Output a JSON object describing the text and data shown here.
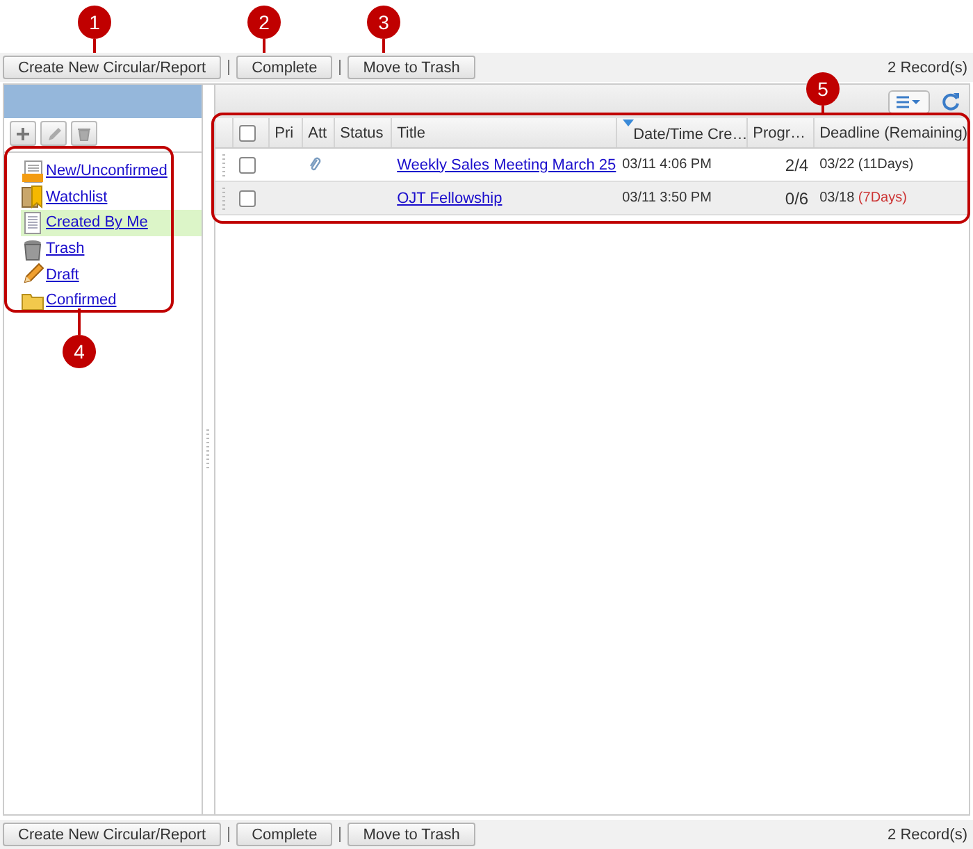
{
  "toolbar_top": {
    "buttons": [
      "Create New Circular/Report",
      "Complete",
      "Move to Trash"
    ],
    "record_count": "2 Record(s)"
  },
  "sidebar": {
    "items": [
      {
        "label": "New/Unconfirmed",
        "kind": "new",
        "selected": false
      },
      {
        "label": "Watchlist",
        "kind": "watch",
        "selected": false
      },
      {
        "label": "Created By Me",
        "kind": "doc",
        "selected": true
      },
      {
        "label": "Trash",
        "kind": "trash",
        "selected": false
      },
      {
        "label": "Draft",
        "kind": "draft",
        "selected": false
      },
      {
        "label": "Confirmed",
        "kind": "folder",
        "selected": false
      }
    ]
  },
  "table": {
    "select_all": {
      "checked": false
    },
    "columns": [
      {
        "label": "Pri",
        "sorted": false
      },
      {
        "label": "Att",
        "sorted": false
      },
      {
        "label": "Status",
        "sorted": false
      },
      {
        "label": "Title",
        "sorted": false
      },
      {
        "label": "Date/Time Cre…",
        "sorted": true
      },
      {
        "label": "Progr…",
        "sorted": false
      },
      {
        "label": "Deadline (Remaining)",
        "sorted": false
      }
    ],
    "rows": [
      {
        "checked": false,
        "attachment": true,
        "title": "Weekly Sales Meeting March 25",
        "created": "03/11 4:06 PM",
        "progress": "2/4",
        "deadline": "03/22",
        "remaining": "(11Days)",
        "color": "#333333"
      },
      {
        "checked": false,
        "attachment": false,
        "title": "OJT Fellowship",
        "created": "03/11 3:50 PM",
        "progress": "0/6",
        "deadline": "03/18",
        "remaining": "(7Days)",
        "color": "#cc3333"
      }
    ]
  },
  "toolbar_bottom": {
    "buttons": [
      "Create New Circular/Report",
      "Complete",
      "Move to Trash"
    ],
    "record_count": "2 Record(s)"
  },
  "callouts": [
    {
      "number": "1"
    },
    {
      "number": "2"
    },
    {
      "number": "3"
    },
    {
      "number": "4"
    },
    {
      "number": "5"
    }
  ]
}
